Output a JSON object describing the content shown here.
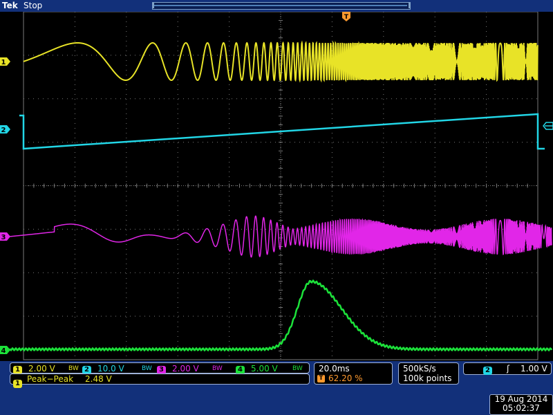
{
  "header": {
    "brand": "Tek",
    "run_state": "Stop",
    "trigger_marker": "T"
  },
  "channels": [
    {
      "id": "1",
      "scale": "2.00 V",
      "color": "#e8e327"
    },
    {
      "id": "2",
      "scale": "10.0 V",
      "color": "#22d6e6"
    },
    {
      "id": "3",
      "scale": "2.00 V",
      "color": "#e126e8"
    },
    {
      "id": "4",
      "scale": "5.00 V",
      "color": "#1ce23a"
    }
  ],
  "bw_symbol": "BW",
  "measurement": {
    "channel": "1",
    "label": "Peak−Peak",
    "value": "2.48 V"
  },
  "horizontal": {
    "time_per_div": "20.0ms",
    "trigger_position": "62.20 %"
  },
  "acquisition": {
    "sample_rate": "500kS/s",
    "record_length": "100k points"
  },
  "trigger": {
    "channel": "2",
    "slope": "ʃ",
    "level": "1.00 V"
  },
  "datetime": {
    "date": "19 Aug 2014",
    "time": "05:02:37"
  },
  "colors": {
    "background": "#000000",
    "panel": "#12307a",
    "grid": "#7a7a7a",
    "trigger_accent": "#ff9a2e"
  }
}
